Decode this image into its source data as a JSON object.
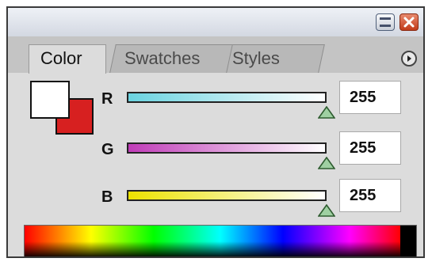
{
  "window": {
    "minimize_icon": "minimize-icon",
    "close_icon": "close-icon"
  },
  "tabs": [
    {
      "label": "Color",
      "active": true
    },
    {
      "label": "Swatches",
      "active": false
    },
    {
      "label": "Styles",
      "active": false
    }
  ],
  "panel_menu_icon": "panel-menu-icon",
  "swatches": {
    "foreground": "#ffffff",
    "background": "#d72020"
  },
  "channels": [
    {
      "label": "R",
      "value": "255",
      "gradient": [
        "#6ad3e0",
        "#ffffff"
      ]
    },
    {
      "label": "G",
      "value": "255",
      "gradient": [
        "#c03cb8",
        "#ffffff"
      ]
    },
    {
      "label": "B",
      "value": "255",
      "gradient": [
        "#ece200",
        "#ffffff"
      ]
    }
  ],
  "spectrum": {
    "description_icon": "color-spectrum-ramp"
  },
  "colors": {
    "panel_bg": "#dcdcdc",
    "thumb_fill": "#9fd0a2"
  }
}
